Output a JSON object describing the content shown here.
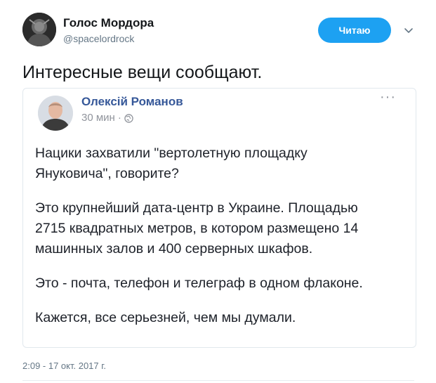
{
  "tweet": {
    "author": {
      "display_name": "Голос Мордора",
      "handle": "@spacelordrock",
      "avatar_icon": "profile-avatar"
    },
    "follow_label": "Читаю",
    "text": "Интересные вещи сообщают.",
    "timestamp": "2:09 - 17 окт. 2017 г.",
    "accent_color": "#1da1f2"
  },
  "embedded_post": {
    "author": "Олексій Романов",
    "time": "30 мин",
    "separator": "·",
    "privacy_icon": "globe-icon",
    "more_icon": "more-horizontal-icon",
    "link_color": "#365899",
    "paragraphs": [
      "Нацики захватили \"вертолетную площадку\nЯнуковича\", говорите?",
      "Это крупнейший дата-центр в Украине. Площадью\n2715 квадратных метров, в котором размещено 14\nмашинных залов и 400 серверных шкафов.",
      "Это - почта, телефон и телеграф в одном флаконе.",
      "Кажется, все серьезней, чем мы думали."
    ]
  }
}
